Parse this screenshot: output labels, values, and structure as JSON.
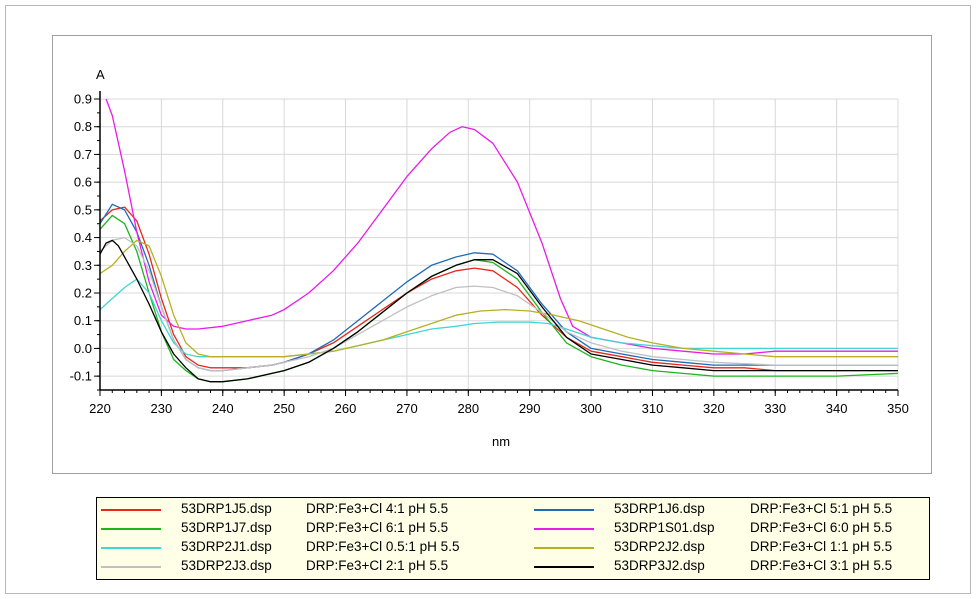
{
  "chart_data": {
    "type": "line",
    "title": "",
    "xlabel": "nm",
    "ylabel": "A",
    "xlim": [
      220,
      350
    ],
    "ylim": [
      -0.15,
      0.9
    ],
    "xticks": [
      220,
      230,
      240,
      250,
      260,
      270,
      280,
      290,
      300,
      310,
      320,
      330,
      340,
      350
    ],
    "yticks": [
      -0.1,
      0.0,
      0.1,
      0.2,
      0.3,
      0.4,
      0.5,
      0.6,
      0.7,
      0.8,
      0.9
    ],
    "ytick_labels": [
      "-0.1",
      "0.0",
      "0.1",
      "0.2",
      "0.3",
      "0.4",
      "0.5",
      "0.6",
      "0.7",
      "0.8",
      "0.9"
    ],
    "grid": true,
    "series": [
      {
        "name": "53DRP1J5.dsp",
        "description": "DRP:Fe3+Cl 4:1 pH 5.5",
        "color": "#e8261c",
        "points": [
          [
            220,
            0.46
          ],
          [
            222,
            0.5
          ],
          [
            224,
            0.51
          ],
          [
            226,
            0.46
          ],
          [
            228,
            0.34
          ],
          [
            230,
            0.18
          ],
          [
            232,
            0.05
          ],
          [
            234,
            -0.03
          ],
          [
            236,
            -0.06
          ],
          [
            238,
            -0.07
          ],
          [
            240,
            -0.07
          ],
          [
            244,
            -0.07
          ],
          [
            248,
            -0.06
          ],
          [
            250,
            -0.05
          ],
          [
            254,
            -0.02
          ],
          [
            258,
            0.02
          ],
          [
            262,
            0.08
          ],
          [
            266,
            0.14
          ],
          [
            270,
            0.2
          ],
          [
            274,
            0.25
          ],
          [
            278,
            0.28
          ],
          [
            281,
            0.29
          ],
          [
            284,
            0.28
          ],
          [
            288,
            0.22
          ],
          [
            292,
            0.12
          ],
          [
            296,
            0.04
          ],
          [
            300,
            -0.01
          ],
          [
            305,
            -0.03
          ],
          [
            310,
            -0.05
          ],
          [
            315,
            -0.06
          ],
          [
            320,
            -0.07
          ],
          [
            325,
            -0.07
          ],
          [
            330,
            -0.08
          ],
          [
            340,
            -0.08
          ],
          [
            350,
            -0.08
          ]
        ]
      },
      {
        "name": "53DRP1J6.dsp",
        "description": "DRP:Fe3+Cl 5:1 pH 5.5",
        "color": "#1f6bb5",
        "points": [
          [
            220,
            0.45
          ],
          [
            222,
            0.52
          ],
          [
            224,
            0.5
          ],
          [
            226,
            0.42
          ],
          [
            228,
            0.3
          ],
          [
            230,
            0.15
          ],
          [
            232,
            0.03
          ],
          [
            234,
            -0.04
          ],
          [
            236,
            -0.07
          ],
          [
            238,
            -0.08
          ],
          [
            240,
            -0.08
          ],
          [
            244,
            -0.07
          ],
          [
            248,
            -0.06
          ],
          [
            250,
            -0.05
          ],
          [
            254,
            -0.02
          ],
          [
            258,
            0.03
          ],
          [
            262,
            0.1
          ],
          [
            266,
            0.17
          ],
          [
            270,
            0.24
          ],
          [
            274,
            0.3
          ],
          [
            278,
            0.33
          ],
          [
            281,
            0.345
          ],
          [
            284,
            0.34
          ],
          [
            288,
            0.28
          ],
          [
            292,
            0.16
          ],
          [
            296,
            0.06
          ],
          [
            300,
            0.0
          ],
          [
            305,
            -0.02
          ],
          [
            310,
            -0.04
          ],
          [
            315,
            -0.05
          ],
          [
            320,
            -0.06
          ],
          [
            325,
            -0.06
          ],
          [
            330,
            -0.06
          ],
          [
            340,
            -0.06
          ],
          [
            350,
            -0.06
          ]
        ]
      },
      {
        "name": "53DRP1J7.dsp",
        "description": "DRP:Fe3+Cl 6:1 pH 5.5",
        "color": "#1cb51c",
        "points": [
          [
            220,
            0.43
          ],
          [
            222,
            0.48
          ],
          [
            224,
            0.45
          ],
          [
            226,
            0.35
          ],
          [
            228,
            0.2
          ],
          [
            230,
            0.06
          ],
          [
            232,
            -0.04
          ],
          [
            234,
            -0.08
          ],
          [
            236,
            -0.11
          ],
          [
            238,
            -0.12
          ],
          [
            240,
            -0.12
          ],
          [
            244,
            -0.11
          ],
          [
            248,
            -0.09
          ],
          [
            250,
            -0.08
          ],
          [
            254,
            -0.05
          ],
          [
            258,
            0.0
          ],
          [
            262,
            0.06
          ],
          [
            266,
            0.13
          ],
          [
            270,
            0.2
          ],
          [
            274,
            0.26
          ],
          [
            278,
            0.3
          ],
          [
            281,
            0.32
          ],
          [
            284,
            0.31
          ],
          [
            288,
            0.25
          ],
          [
            292,
            0.13
          ],
          [
            296,
            0.02
          ],
          [
            300,
            -0.03
          ],
          [
            305,
            -0.06
          ],
          [
            310,
            -0.08
          ],
          [
            315,
            -0.09
          ],
          [
            320,
            -0.1
          ],
          [
            325,
            -0.1
          ],
          [
            330,
            -0.1
          ],
          [
            340,
            -0.1
          ],
          [
            350,
            -0.09
          ]
        ]
      },
      {
        "name": "53DRP1S01.dsp",
        "description": "DRP:Fe3+Cl 6:0 pH 5.5",
        "color": "#e81ce8",
        "points": [
          [
            221,
            0.9
          ],
          [
            222,
            0.84
          ],
          [
            224,
            0.64
          ],
          [
            226,
            0.42
          ],
          [
            228,
            0.24
          ],
          [
            230,
            0.12
          ],
          [
            232,
            0.08
          ],
          [
            234,
            0.07
          ],
          [
            236,
            0.07
          ],
          [
            240,
            0.08
          ],
          [
            244,
            0.1
          ],
          [
            248,
            0.12
          ],
          [
            250,
            0.14
          ],
          [
            254,
            0.2
          ],
          [
            258,
            0.28
          ],
          [
            262,
            0.38
          ],
          [
            266,
            0.5
          ],
          [
            270,
            0.62
          ],
          [
            274,
            0.72
          ],
          [
            277,
            0.78
          ],
          [
            279,
            0.8
          ],
          [
            281,
            0.79
          ],
          [
            284,
            0.74
          ],
          [
            288,
            0.6
          ],
          [
            292,
            0.38
          ],
          [
            295,
            0.18
          ],
          [
            297,
            0.08
          ],
          [
            300,
            0.04
          ],
          [
            305,
            0.02
          ],
          [
            310,
            0.0
          ],
          [
            315,
            -0.01
          ],
          [
            320,
            -0.02
          ],
          [
            325,
            -0.02
          ],
          [
            330,
            -0.01
          ],
          [
            340,
            -0.01
          ],
          [
            350,
            -0.01
          ]
        ]
      },
      {
        "name": "53DRP2J1.dsp",
        "description": "DRP:Fe3+Cl 0.5:1 pH 5.5",
        "color": "#3fd6d6",
        "points": [
          [
            220,
            0.14
          ],
          [
            222,
            0.18
          ],
          [
            224,
            0.22
          ],
          [
            226,
            0.25
          ],
          [
            228,
            0.2
          ],
          [
            230,
            0.1
          ],
          [
            232,
            0.02
          ],
          [
            234,
            -0.02
          ],
          [
            236,
            -0.03
          ],
          [
            240,
            -0.03
          ],
          [
            244,
            -0.03
          ],
          [
            248,
            -0.03
          ],
          [
            250,
            -0.03
          ],
          [
            254,
            -0.02
          ],
          [
            258,
            -0.01
          ],
          [
            262,
            0.01
          ],
          [
            266,
            0.03
          ],
          [
            270,
            0.05
          ],
          [
            274,
            0.07
          ],
          [
            278,
            0.08
          ],
          [
            281,
            0.09
          ],
          [
            285,
            0.095
          ],
          [
            290,
            0.095
          ],
          [
            293,
            0.09
          ],
          [
            296,
            0.07
          ],
          [
            300,
            0.04
          ],
          [
            305,
            0.02
          ],
          [
            310,
            0.01
          ],
          [
            315,
            0.0
          ],
          [
            320,
            0.0
          ],
          [
            330,
            0.0
          ],
          [
            340,
            0.0
          ],
          [
            350,
            0.0
          ]
        ]
      },
      {
        "name": "53DRP2J2.dsp",
        "description": "DRP:Fe3+Cl 1:1 pH 5.5",
        "color": "#b8b020",
        "points": [
          [
            220,
            0.27
          ],
          [
            222,
            0.3
          ],
          [
            224,
            0.35
          ],
          [
            226,
            0.39
          ],
          [
            228,
            0.37
          ],
          [
            230,
            0.26
          ],
          [
            232,
            0.12
          ],
          [
            234,
            0.02
          ],
          [
            236,
            -0.02
          ],
          [
            238,
            -0.03
          ],
          [
            240,
            -0.03
          ],
          [
            244,
            -0.03
          ],
          [
            248,
            -0.03
          ],
          [
            250,
            -0.03
          ],
          [
            254,
            -0.02
          ],
          [
            258,
            -0.01
          ],
          [
            262,
            0.01
          ],
          [
            266,
            0.03
          ],
          [
            270,
            0.06
          ],
          [
            274,
            0.09
          ],
          [
            278,
            0.12
          ],
          [
            282,
            0.135
          ],
          [
            286,
            0.14
          ],
          [
            290,
            0.135
          ],
          [
            294,
            0.12
          ],
          [
            298,
            0.1
          ],
          [
            302,
            0.07
          ],
          [
            306,
            0.04
          ],
          [
            310,
            0.02
          ],
          [
            315,
            0.0
          ],
          [
            320,
            -0.01
          ],
          [
            325,
            -0.02
          ],
          [
            330,
            -0.03
          ],
          [
            340,
            -0.03
          ],
          [
            350,
            -0.03
          ]
        ]
      },
      {
        "name": "53DRP2J3.dsp",
        "description": "DRP:Fe3+Cl 2:1 pH 5.5",
        "color": "#c0c0c0",
        "points": [
          [
            220,
            0.35
          ],
          [
            222,
            0.39
          ],
          [
            224,
            0.4
          ],
          [
            226,
            0.37
          ],
          [
            228,
            0.28
          ],
          [
            230,
            0.15
          ],
          [
            232,
            0.03
          ],
          [
            234,
            -0.04
          ],
          [
            236,
            -0.07
          ],
          [
            238,
            -0.08
          ],
          [
            240,
            -0.08
          ],
          [
            244,
            -0.07
          ],
          [
            248,
            -0.06
          ],
          [
            250,
            -0.05
          ],
          [
            254,
            -0.03
          ],
          [
            258,
            0.0
          ],
          [
            262,
            0.05
          ],
          [
            266,
            0.1
          ],
          [
            270,
            0.15
          ],
          [
            274,
            0.19
          ],
          [
            278,
            0.22
          ],
          [
            281,
            0.225
          ],
          [
            284,
            0.22
          ],
          [
            288,
            0.19
          ],
          [
            292,
            0.13
          ],
          [
            296,
            0.06
          ],
          [
            300,
            0.02
          ],
          [
            305,
            -0.01
          ],
          [
            310,
            -0.03
          ],
          [
            315,
            -0.04
          ],
          [
            320,
            -0.05
          ],
          [
            330,
            -0.06
          ],
          [
            340,
            -0.06
          ],
          [
            350,
            -0.06
          ]
        ]
      },
      {
        "name": "53DRP3J2.dsp",
        "description": "DRP:Fe3+Cl 3:1 pH 5.5",
        "color": "#000000",
        "points": [
          [
            220,
            0.34
          ],
          [
            221,
            0.38
          ],
          [
            222,
            0.39
          ],
          [
            223,
            0.37
          ],
          [
            224,
            0.33
          ],
          [
            226,
            0.25
          ],
          [
            228,
            0.16
          ],
          [
            230,
            0.06
          ],
          [
            232,
            -0.02
          ],
          [
            234,
            -0.07
          ],
          [
            236,
            -0.11
          ],
          [
            238,
            -0.12
          ],
          [
            240,
            -0.12
          ],
          [
            244,
            -0.11
          ],
          [
            248,
            -0.09
          ],
          [
            250,
            -0.08
          ],
          [
            254,
            -0.05
          ],
          [
            258,
            0.0
          ],
          [
            262,
            0.06
          ],
          [
            266,
            0.13
          ],
          [
            270,
            0.2
          ],
          [
            274,
            0.26
          ],
          [
            278,
            0.3
          ],
          [
            281,
            0.32
          ],
          [
            284,
            0.32
          ],
          [
            288,
            0.27
          ],
          [
            292,
            0.15
          ],
          [
            296,
            0.04
          ],
          [
            300,
            -0.02
          ],
          [
            305,
            -0.04
          ],
          [
            310,
            -0.06
          ],
          [
            315,
            -0.07
          ],
          [
            320,
            -0.08
          ],
          [
            325,
            -0.08
          ],
          [
            330,
            -0.08
          ],
          [
            340,
            -0.08
          ],
          [
            350,
            -0.08
          ]
        ]
      }
    ]
  },
  "legend": {
    "items": [
      {
        "file": "53DRP1J5.dsp",
        "desc": "DRP:Fe3+Cl 4:1 pH 5.5",
        "color": "#e8261c"
      },
      {
        "file": "53DRP1J6.dsp",
        "desc": "DRP:Fe3+Cl 5:1 pH 5.5",
        "color": "#1f6bb5"
      },
      {
        "file": "53DRP1J7.dsp",
        "desc": "DRP:Fe3+Cl 6:1 pH 5.5",
        "color": "#1cb51c"
      },
      {
        "file": "53DRP1S01.dsp",
        "desc": "DRP:Fe3+Cl 6:0 pH 5.5",
        "color": "#e81ce8"
      },
      {
        "file": "53DRP2J1.dsp",
        "desc": "DRP:Fe3+Cl 0.5:1 pH 5.5",
        "color": "#3fd6d6"
      },
      {
        "file": "53DRP2J2.dsp",
        "desc": "DRP:Fe3+Cl 1:1 pH 5.5",
        "color": "#b8b020"
      },
      {
        "file": "53DRP2J3.dsp",
        "desc": "DRP:Fe3+Cl 2:1 pH 5.5",
        "color": "#c0c0c0"
      },
      {
        "file": "53DRP3J2.dsp",
        "desc": "DRP:Fe3+Cl 3:1 pH 5.5",
        "color": "#000000"
      }
    ]
  }
}
